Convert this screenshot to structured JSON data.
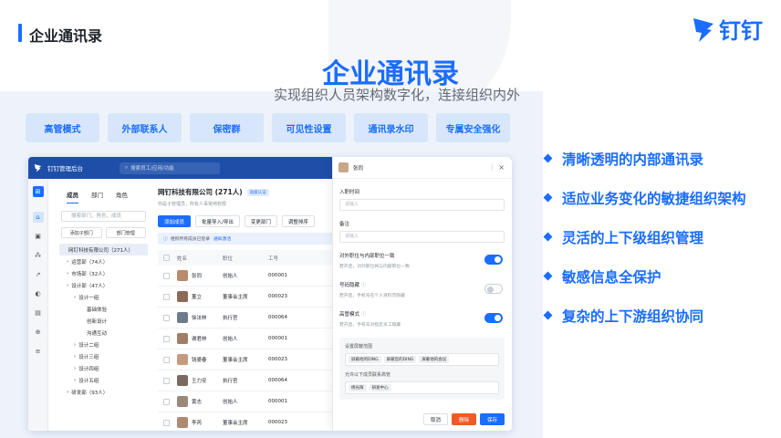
{
  "header": {
    "title": "企业通讯录"
  },
  "logo": {
    "text": "钉钉"
  },
  "hero": {
    "title": "企业通讯录",
    "subtitle": "实现组织人员架构数字化，连接组织内外"
  },
  "chips": [
    "高管模式",
    "外部联系人",
    "保密群",
    "可见性设置",
    "通讯录水印",
    "专属安全强化"
  ],
  "features": [
    "清晰透明的内部通讯录",
    "适应业务变化的敏捷组织架构",
    "灵活的上下级组织管理",
    "敏感信息全保护",
    "复杂的上下游组织协同"
  ],
  "app": {
    "name": "钉钉管理后台",
    "search_placeholder": "搜索员工/应用/功能",
    "tabs": [
      "成员",
      "部门",
      "角色"
    ],
    "tree_search": "搜索部门、角色、成员",
    "tree_buttons": [
      "添加子部门",
      "部门管理"
    ],
    "tree_root": "网钉科技有限公司（271人）",
    "tree_nodes": [
      {
        "label": "运营部（74人）",
        "indent": 1
      },
      {
        "label": "市场部（32人）",
        "indent": 1
      },
      {
        "label": "设计部（47人）",
        "indent": 1
      },
      {
        "label": "设计一组",
        "indent": 2
      },
      {
        "label": "基础体验",
        "indent": 3
      },
      {
        "label": "创新设计",
        "indent": 3
      },
      {
        "label": "沟通互动",
        "indent": 3
      },
      {
        "label": "设计二组",
        "indent": 2
      },
      {
        "label": "设计三组",
        "indent": 2
      },
      {
        "label": "设计四组",
        "indent": 2
      },
      {
        "label": "设计五组",
        "indent": 2
      },
      {
        "label": "研发部（93人）",
        "indent": 1
      }
    ],
    "company": "网钉科技有限公司 (271人)",
    "company_badge": "高级认证",
    "company_sub": "你是子管理员，所有人事常用权限",
    "actions": [
      "添加成员",
      "批量导入/导出",
      "变更部门",
      "调整排序"
    ],
    "notice": "组织所有成员已登录",
    "notice_link": "通知激活",
    "columns": [
      "姓名",
      "职位",
      "工号"
    ],
    "rows": [
      {
        "name": "张同",
        "title": "创始人",
        "id": "000001"
      },
      {
        "name": "董立",
        "title": "董事会主席",
        "id": "000023"
      },
      {
        "name": "徐法林",
        "title": "执行官",
        "id": "000064"
      },
      {
        "name": "谢君林",
        "title": "创始人",
        "id": "000001"
      },
      {
        "name": "钱婆春",
        "title": "董事会主席",
        "id": "000023"
      },
      {
        "name": "王力安",
        "title": "执行官",
        "id": "000064"
      },
      {
        "name": "黄志",
        "title": "创始人",
        "id": "000001"
      },
      {
        "name": "李芮",
        "title": "董事会主席",
        "id": "000023"
      }
    ],
    "drawer": {
      "name": "张同",
      "field1_label": "入职时间",
      "field1_placeholder": "请输入",
      "field2_label": "备注",
      "field2_placeholder": "请输入",
      "switch1_label": "对外职位与内部职位一致",
      "switch1_desc": "若开启，对外职位将与内部职位一致",
      "switch2_label": "号码隐藏",
      "switch2_desc": "若开启，手机号在个人资料页隐藏",
      "switch3_label": "高管模式",
      "switch3_desc": "若开启，手机号对指定员工隐藏",
      "box1_label": "设置屏蔽范围",
      "box1_tags": [
        "屏蔽他的DING",
        "屏蔽您的DING",
        "屏蔽他的会议"
      ],
      "box2_label": "允许以下成员联系高管",
      "box2_tags": [
        "杨光辉",
        "研发中心"
      ],
      "buttons": [
        "取消",
        "删除",
        "保存"
      ]
    }
  }
}
